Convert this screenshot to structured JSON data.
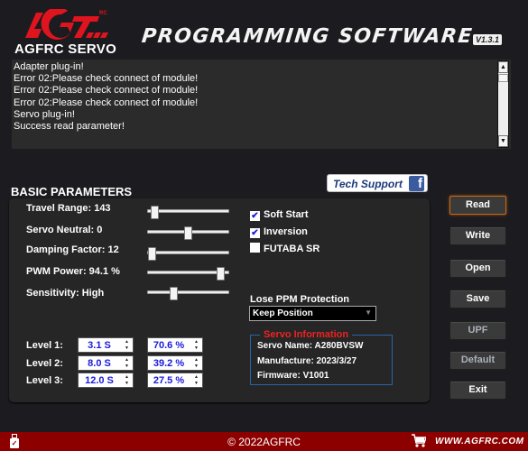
{
  "header": {
    "brand": "AGFRC SERVO",
    "logo_superscript": "RC",
    "title": "PROGRAMMING SOFTWARE",
    "version": "V1.3.1"
  },
  "log": {
    "lines": [
      "Adapter plug-in!",
      "Error 02:Please check connect of module!",
      "Error 02:Please check connect of module!",
      "Error 02:Please check connect of module!",
      "Servo plug-in!",
      "Success read parameter!"
    ],
    "scroll_up": "▲",
    "scroll_down": "▼"
  },
  "section": {
    "title": "BASIC PARAMETERS",
    "tech_support": "Tech Support",
    "facebook_glyph": "f"
  },
  "params": [
    {
      "label": "Travel Range: 143",
      "slider_fraction": 0.09
    },
    {
      "label": "Servo Neutral: 0",
      "slider_fraction": 0.49
    },
    {
      "label": "Damping Factor: 12",
      "slider_fraction": 0.05
    },
    {
      "label": "PWM Power: 94.1 %",
      "slider_fraction": 0.89
    },
    {
      "label": "Sensitivity: High",
      "slider_fraction": 0.32
    }
  ],
  "options": [
    {
      "label": "Soft Start",
      "checked": true
    },
    {
      "label": "Inversion",
      "checked": true
    },
    {
      "label": "FUTABA SR",
      "checked": false
    }
  ],
  "ppm": {
    "label": "Lose PPM Protection",
    "selected": "Keep Position"
  },
  "servo_info": {
    "title": "Servo Information",
    "name": "Servo Name: A280BVSW",
    "manufacture": "Manufacture: 2023/3/27",
    "firmware": "Firmware: V1001"
  },
  "levels": [
    {
      "label": "Level 1:",
      "time": "3.1 S",
      "percent": "70.6 %"
    },
    {
      "label": "Level 2:",
      "time": "8.0 S",
      "percent": "39.2 %"
    },
    {
      "label": "Level 3:",
      "time": "12.0 S",
      "percent": "27.5 %"
    }
  ],
  "buttons": {
    "read": "Read",
    "write": "Write",
    "open": "Open",
    "save": "Save",
    "upf": "UPF",
    "default": "Default",
    "exit": "Exit"
  },
  "footer": {
    "copyright": "© 2022AGFRC",
    "website": "WWW.AGFRC.COM",
    "usb_check": "✓",
    "cart_glyph": "🛒"
  },
  "colors": {
    "accent_red": "#8d0000",
    "logo_red": "#e0141e",
    "value_blue": "#1a1adb",
    "info_title_red": "#e22222",
    "info_border_blue": "#2a64a8"
  }
}
